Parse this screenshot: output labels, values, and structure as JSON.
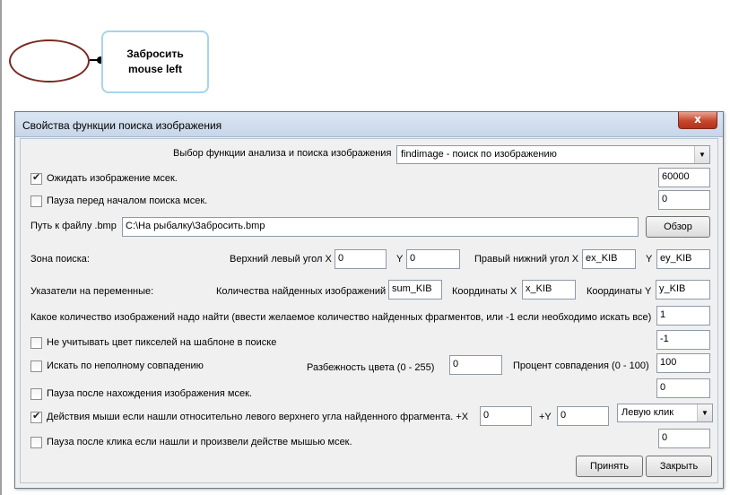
{
  "canvas": {
    "node_label_line1": "Забросить",
    "node_label_line2": "mouse left"
  },
  "window": {
    "title": "Свойства функции поиска изображения",
    "close_glyph": "x"
  },
  "form": {
    "func_label": "Выбор функции анализа и поиска изображения",
    "func_value": "findimage - поиск по изображению",
    "wait_label": "Ожидать изображение мсек.",
    "wait_checked": true,
    "wait_value": "60000",
    "pause_before_label": "Пауза перед началом поиска мсек.",
    "pause_before_checked": false,
    "pause_before_value": "0",
    "path_label": "Путь к файлу .bmp",
    "path_value": "C:\\На рыбалку\\Забросить.bmp",
    "browse_label": "Обзор",
    "zone_label": "Зона поиска:",
    "top_left_label": "Верхний левый угол X",
    "top_left_x": "0",
    "y_label": "Y",
    "top_left_y": "0",
    "bottom_right_label": "Правый нижний угол X",
    "bottom_right_x": "ex_KIB",
    "y_label2": "Y",
    "bottom_right_y": "ey_KIB",
    "vars_label": "Указатели на переменные:",
    "count_found_label": "Количества найденных изображений",
    "count_found_value": "sum_KIB",
    "coord_x_label": "Координаты X",
    "coord_x_value": "x_KIB",
    "coord_y_label": "Координаты Y",
    "coord_y_value": "y_KIB",
    "how_many_label": "Какое количество изображений надо найти (ввести желаемое количество найденных фрагментов, или -1 если необходимо искать все)",
    "how_many_value": "1",
    "ignore_color_label": "Не учитывать цвет пикселей на шаблоне в поиске",
    "ignore_color_checked": false,
    "ignore_color_value": "-1",
    "partial_label": "Искать по неполному совпадению",
    "partial_checked": false,
    "color_spread_label": "Разбежность цвета (0 - 255)",
    "color_spread_value": "0",
    "match_percent_label": "Процент совпадения (0 - 100)",
    "match_percent_value": "100",
    "pause_after_find_label": "Пауза после нахождения изображения мсек.",
    "pause_after_find_checked": false,
    "pause_after_find_value": "0",
    "mouse_action_label": "Действия мыши если нашли относительно левого верхнего угла найденного фрагмента. +X",
    "mouse_action_checked": true,
    "mouse_x_value": "0",
    "mouse_y_label": "+Y",
    "mouse_y_value": "0",
    "mouse_click_value": "Левую клик",
    "pause_after_click_label": "Пауза после клика если нашли и произвели действе мышью мсек.",
    "pause_after_click_checked": false,
    "pause_after_click_value": "0",
    "accept_label": "Принять",
    "close_label": "Закрыть"
  },
  "colors": {
    "ellipse_border": "#7a2a20",
    "node_border": "#a8d4ea",
    "close_button": "#c7452b"
  }
}
